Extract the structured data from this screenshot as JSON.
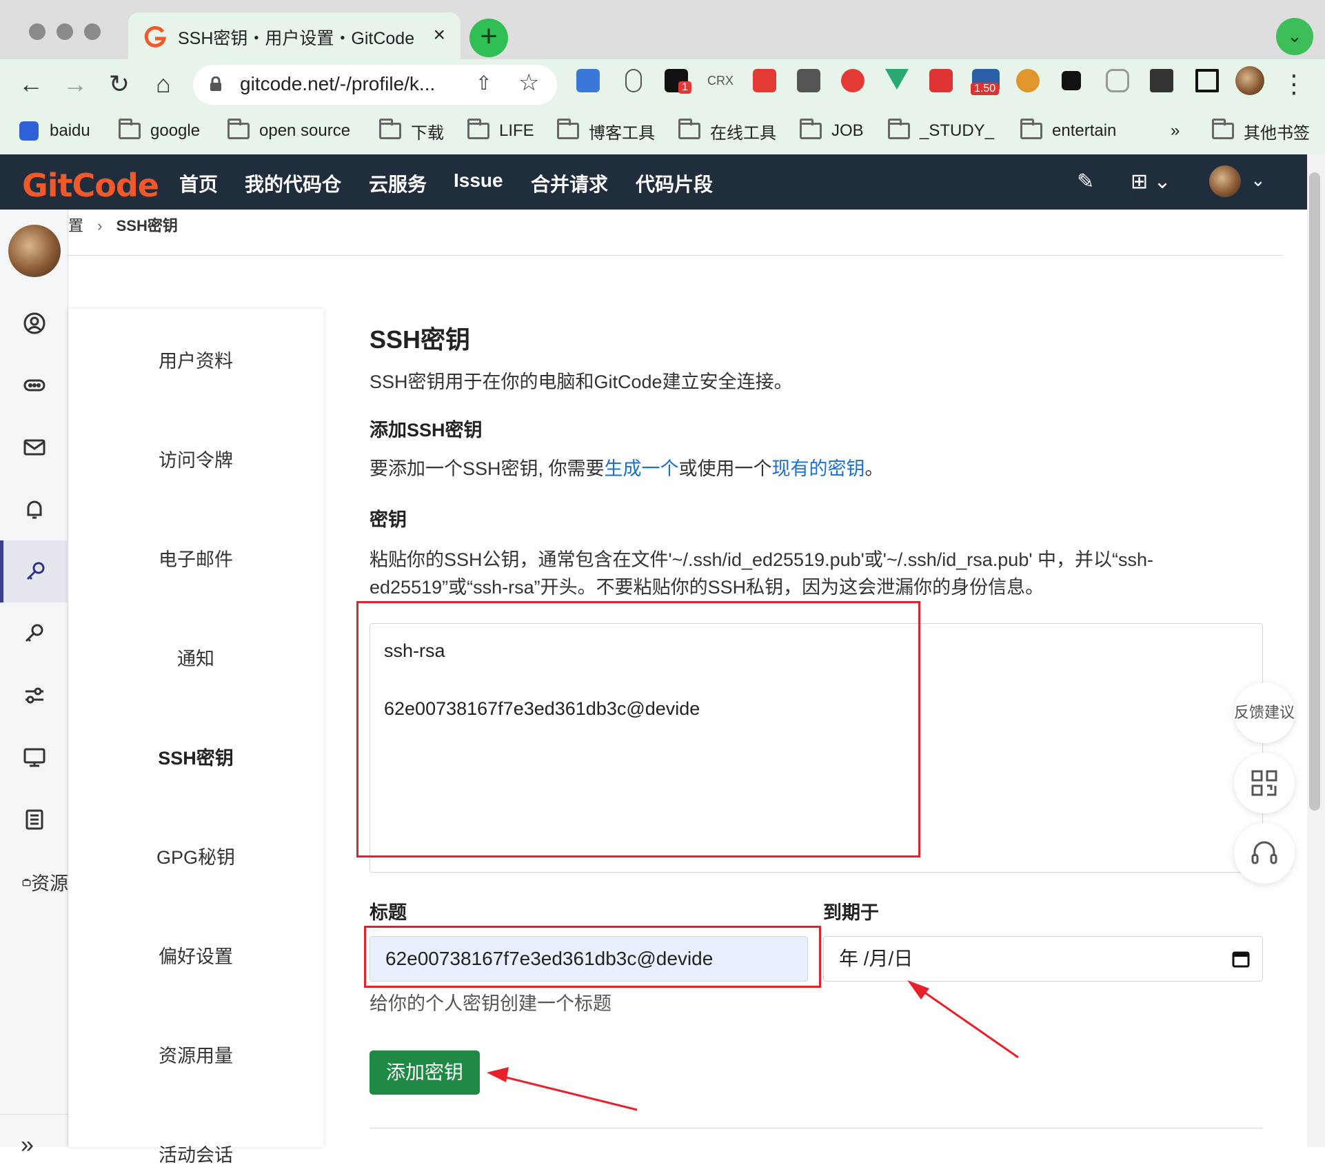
{
  "browser": {
    "tab_title": "SSH密钥・用户设置・GitCode",
    "tab_close": "×",
    "new_tab": "+",
    "url": "gitcode.net/-/profile/k...",
    "ext_badge_1": "1",
    "ext_crx": "CRX",
    "ext_badge_2": "1.50",
    "bookmarks": [
      "baidu",
      "google",
      "open source",
      "下载",
      "LIFE",
      "博客工具",
      "在线工具",
      "JOB",
      "_STUDY_",
      "entertain"
    ],
    "bookmarks_more": "»",
    "other_bookmarks": "其他书签"
  },
  "app": {
    "logo": "GitCode",
    "nav": [
      "首页",
      "我的代码仓",
      "云服务",
      "Issue",
      "合并请求",
      "代码片段"
    ]
  },
  "breadcrumb": {
    "parent": "置",
    "sep": "›",
    "current": "SSH密钥"
  },
  "left_rail": {
    "partial_label": "资源",
    "expand": "»"
  },
  "settings_nav": [
    "用户资料",
    "访问令牌",
    "电子邮件",
    "通知",
    "SSH密钥",
    "GPG秘钥",
    "偏好设置",
    "资源用量",
    "活动会话"
  ],
  "content": {
    "title": "SSH密钥",
    "subtitle": "SSH密钥用于在你的电脑和GitCode建立安全连接。",
    "add_heading": "添加SSH密钥",
    "add_text_1": "要添加一个SSH密钥, 你需要",
    "add_link_1": "生成一个",
    "add_text_2": "或使用一个",
    "add_link_2": "现有的密钥",
    "add_text_3": "。",
    "key_label": "密钥",
    "key_help_1": "粘贴你的SSH公钥，通常包含在文件'~/.ssh/id_ed25519.pub'或'~/.ssh/id_rsa.pub' 中，并以“ssh-",
    "key_help_2": "ed25519”或“ssh-rsa”开头。不要粘贴你的SSH私钥，因为这会泄漏你的身份信息。",
    "key_value_line1": "ssh-rsa",
    "key_value_line2": "62e00738167f7e3ed361db3c@devide",
    "title_label": "标题",
    "title_value": "62e00738167f7e3ed361db3c@devide",
    "title_help": "给你的个人密钥创建一个标题",
    "expire_label": "到期于",
    "expire_placeholder": "年 /月/日",
    "submit": "添加密钥"
  },
  "floating": {
    "feedback": "反馈建议"
  },
  "colors": {
    "accent": "#1e8a43",
    "appbar": "#1f2d3d",
    "logo": "#f1592a",
    "annotation": "#e8202a"
  }
}
